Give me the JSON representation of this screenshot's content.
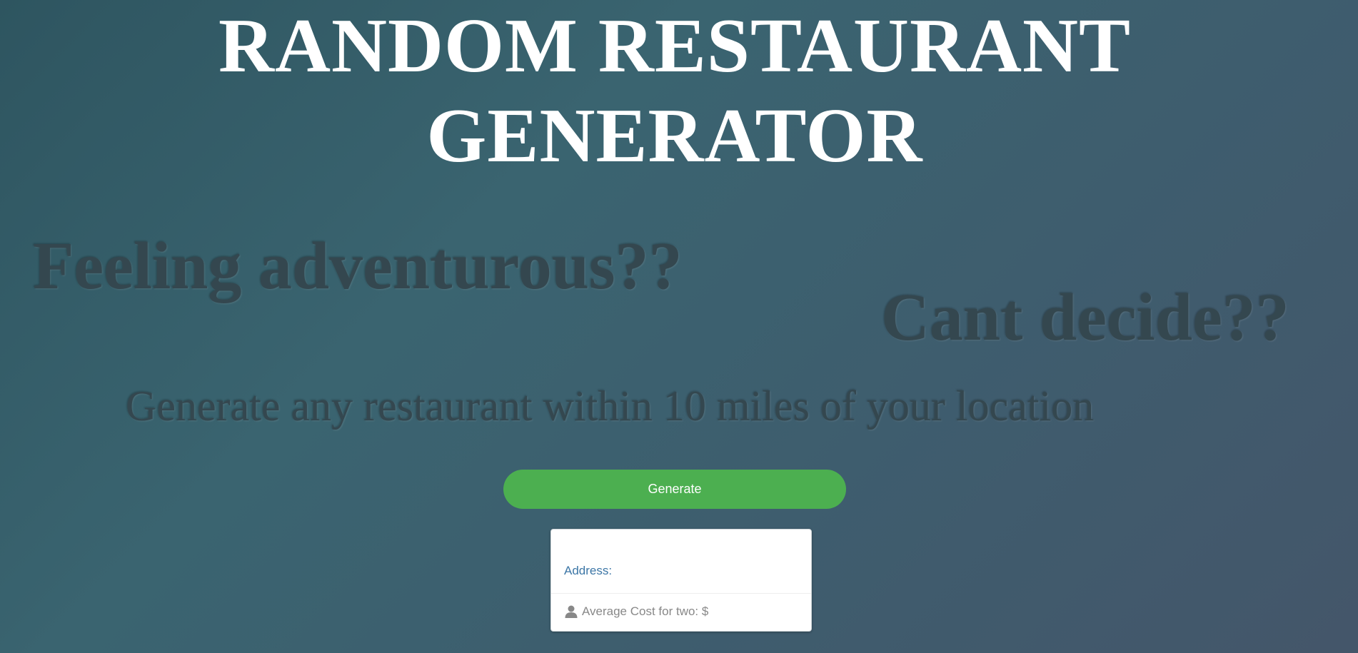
{
  "page": {
    "title_line1": "RANDOM RESTAURANT",
    "title_line2": "GENERATOR"
  },
  "taglines": {
    "feeling": "Feeling adventurous??",
    "cant_decide": "Cant decide??",
    "generate_desc": "Generate any restaurant within 10 miles of your location"
  },
  "actions": {
    "generate_label": "Generate"
  },
  "result_card": {
    "address_label": "Address:",
    "address_value": "",
    "cost_label": "Average Cost for two: $",
    "cost_icon": "user-icon"
  },
  "colors": {
    "button_green": "#4caf50",
    "address_blue": "#3c76a6",
    "ghost_text": "#34474f"
  }
}
